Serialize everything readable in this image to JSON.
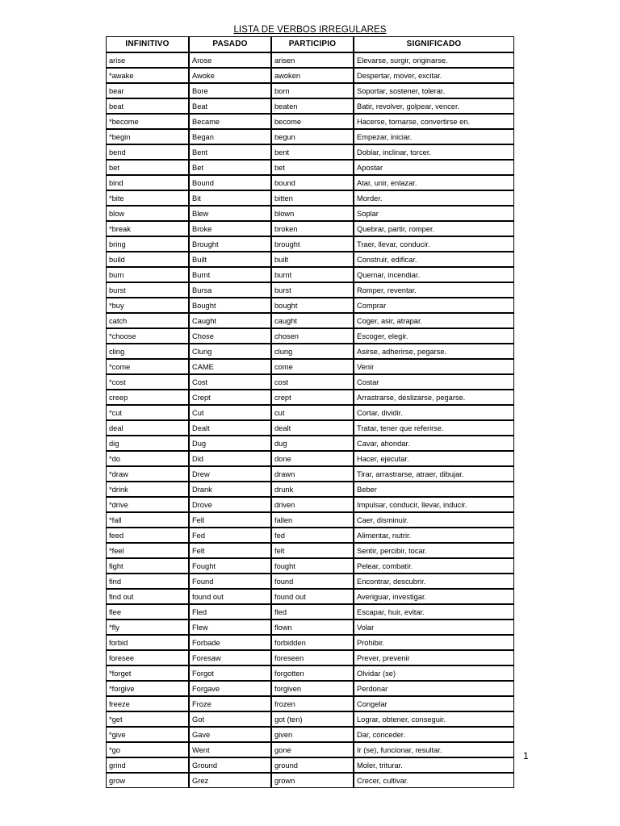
{
  "document": {
    "title": "LISTA DE VERBOS IRREGULARES",
    "page_number": "1"
  },
  "table": {
    "headers": {
      "infinitivo": "INFINITIVO",
      "pasado": "PASADO",
      "participio": "PARTICIPIO",
      "significado": "SIGNIFICADO"
    },
    "rows": [
      {
        "infinitivo": "arise",
        "pasado": "Arose",
        "participio": "arisen",
        "significado": "Elevarse, surgir, originarse."
      },
      {
        "infinitivo": "*awake",
        "pasado": "Awoke",
        "participio": "awoken",
        "significado": "Despertar, mover, excitar."
      },
      {
        "infinitivo": "bear",
        "pasado": "Bore",
        "participio": "born",
        "significado": "Soportar, sostener, tolerar."
      },
      {
        "infinitivo": "beat",
        "pasado": "Beat",
        "participio": "beaten",
        "significado": "Batir, revolver, golpear, vencer."
      },
      {
        "infinitivo": "*become",
        "pasado": "Became",
        "participio": "become",
        "significado": "Hacerse, tornarse, convertirse en."
      },
      {
        "infinitivo": "*begin",
        "pasado": "Began",
        "participio": "begun",
        "significado": "Empezar, iniciar."
      },
      {
        "infinitivo": "bend",
        "pasado": "Bent",
        "participio": "bent",
        "significado": "Doblar, inclinar, torcer."
      },
      {
        "infinitivo": "bet",
        "pasado": "Bet",
        "participio": "bet",
        "significado": "Apostar"
      },
      {
        "infinitivo": "bind",
        "pasado": "Bound",
        "participio": "bound",
        "significado": "Atar, unir, enlazar."
      },
      {
        "infinitivo": "*bite",
        "pasado": "Bit",
        "participio": "bitten",
        "significado": "Morder."
      },
      {
        "infinitivo": "blow",
        "pasado": "Blew",
        "participio": "blown",
        "significado": "Soplar"
      },
      {
        "infinitivo": "*break",
        "pasado": "Broke",
        "participio": "broken",
        "significado": "Quebrar, partir, romper."
      },
      {
        "infinitivo": "bring",
        "pasado": "Brought",
        "participio": "brought",
        "significado": "Traer, llevar, conducir."
      },
      {
        "infinitivo": "build",
        "pasado": "Built",
        "participio": "built",
        "significado": "Construir, edificar."
      },
      {
        "infinitivo": "burn",
        "pasado": "Burnt",
        "participio": "burnt",
        "significado": "Quemar, incendiar."
      },
      {
        "infinitivo": "burst",
        "pasado": "Bursa",
        "participio": "burst",
        "significado": "Romper, reventar."
      },
      {
        "infinitivo": "*buy",
        "pasado": "Bought",
        "participio": "bought",
        "significado": "Comprar"
      },
      {
        "infinitivo": "catch",
        "pasado": "Caught",
        "participio": "caught",
        "significado": "Coger, asir, atrapar."
      },
      {
        "infinitivo": "*choose",
        "pasado": "Chose",
        "participio": "chosen",
        "significado": "Escoger, elegir."
      },
      {
        "infinitivo": "cling",
        "pasado": "Clung",
        "participio": "clung",
        "significado": "Asirse, adherirse, pegarse."
      },
      {
        "infinitivo": "*come",
        "pasado": "CAME",
        "participio": "come",
        "significado": "Venir"
      },
      {
        "infinitivo": "*cost",
        "pasado": "Cost",
        "participio": "cost",
        "significado": "Costar"
      },
      {
        "infinitivo": "creep",
        "pasado": "Crept",
        "participio": "crept",
        "significado": "Arrastrarse, deslizarse, pegarse."
      },
      {
        "infinitivo": "*cut",
        "pasado": "Cut",
        "participio": "cut",
        "significado": "Cortar, dividir."
      },
      {
        "infinitivo": "deal",
        "pasado": "Dealt",
        "participio": "dealt",
        "significado": "Tratar, tener que referirse."
      },
      {
        "infinitivo": "dig",
        "pasado": "Dug",
        "participio": "dug",
        "significado": "Cavar, ahondar."
      },
      {
        "infinitivo": "*do",
        "pasado": "Did",
        "participio": "done",
        "significado": "Hacer, ejecutar."
      },
      {
        "infinitivo": "*draw",
        "pasado": "Drew",
        "participio": "drawn",
        "significado": "Tirar, arrastrarse, atraer, dibujar."
      },
      {
        "infinitivo": "*drink",
        "pasado": "Drank",
        "participio": "drunk",
        "significado": "Beber"
      },
      {
        "infinitivo": "*drive",
        "pasado": "Drove",
        "participio": "driven",
        "significado": "Impulsar, conducir, llevar, inducir."
      },
      {
        "infinitivo": "*fall",
        "pasado": "Fell",
        "participio": "fallen",
        "significado": "Caer, disminuir."
      },
      {
        "infinitivo": "feed",
        "pasado": "Fed",
        "participio": "fed",
        "significado": "Alimentar, nutrir."
      },
      {
        "infinitivo": "*feel",
        "pasado": "Felt",
        "participio": "felt",
        "significado": "Sentir, percibir, tocar."
      },
      {
        "infinitivo": "fight",
        "pasado": "Fought",
        "participio": "fought",
        "significado": "Pelear, combatir."
      },
      {
        "infinitivo": "find",
        "pasado": "Found",
        "participio": "found",
        "significado": "Encontrar, descubrir."
      },
      {
        "infinitivo": "find out",
        "pasado": "found out",
        "participio": "found out",
        "significado": "Averiguar, investigar."
      },
      {
        "infinitivo": "flee",
        "pasado": "Fled",
        "participio": "fled",
        "significado": "Escapar, huir, evitar."
      },
      {
        "infinitivo": "*fly",
        "pasado": "Flew",
        "participio": "flown",
        "significado": "Volar"
      },
      {
        "infinitivo": "forbid",
        "pasado": "Forbade",
        "participio": "forbidden",
        "significado": "Prohibir."
      },
      {
        "infinitivo": "foresee",
        "pasado": "Foresaw",
        "participio": "foreseen",
        "significado": "Prever, prevenir"
      },
      {
        "infinitivo": "*forget",
        "pasado": "Forgot",
        "participio": "forgotten",
        "significado": "Olvidar (se)"
      },
      {
        "infinitivo": "*forgive",
        "pasado": "Forgave",
        "participio": "forgiven",
        "significado": "Perdonar"
      },
      {
        "infinitivo": "freeze",
        "pasado": "Froze",
        "participio": "frozen",
        "significado": "Congelar"
      },
      {
        "infinitivo": "*get",
        "pasado": "Got",
        "participio": "got (ten)",
        "significado": "Lograr, obtener, conseguir."
      },
      {
        "infinitivo": "*give",
        "pasado": "Gave",
        "participio": "given",
        "significado": "Dar, conceder."
      },
      {
        "infinitivo": "*go",
        "pasado": "Went",
        "participio": "gone",
        "significado": "Ir (se), funcionar, resultar."
      },
      {
        "infinitivo": "grind",
        "pasado": "Ground",
        "participio": "ground",
        "significado": "Moler, triturar."
      },
      {
        "infinitivo": "grow",
        "pasado": "Grez",
        "participio": "grown",
        "significado": "Crecer, cultivar."
      }
    ]
  }
}
